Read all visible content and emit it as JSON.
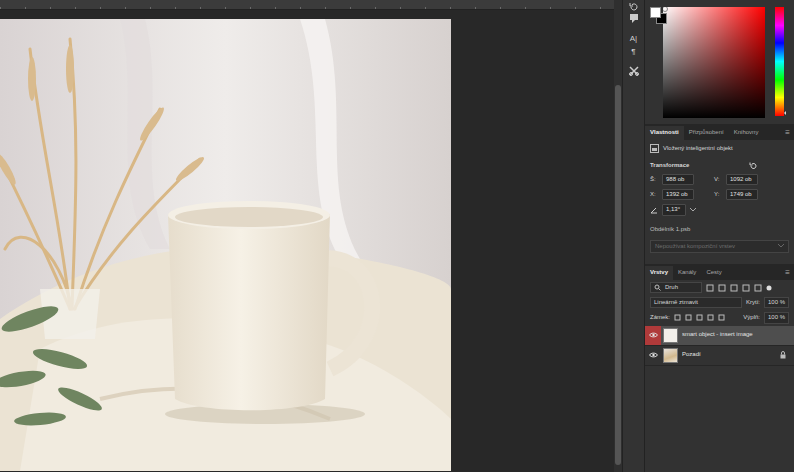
{
  "tool_icons": [
    {
      "glyph": "A|"
    },
    {
      "glyph": "¶"
    }
  ],
  "color": {
    "foreground": "#ffffff",
    "background": "#000000"
  },
  "properties": {
    "tabs": [
      {
        "label": "Vlastnosti",
        "selected": true
      },
      {
        "label": "Přizpůsobení",
        "selected": false
      },
      {
        "label": "Knihovny",
        "selected": false
      }
    ],
    "menu": "≡",
    "subtitle": "Vložený inteligentní objekt",
    "section": "Transformace",
    "fields": [
      {
        "label": "Š:",
        "value": "988 ob"
      },
      {
        "label": "V:",
        "value": "1092 ob"
      },
      {
        "label": "X:",
        "value": "1392 ob"
      },
      {
        "label": "Y:",
        "value": "1749 ob"
      }
    ],
    "angle": "1,13°",
    "file": "Obdélník 1.psb",
    "comp_select": {
      "value": "Nepoužívat kompoziční vrstev",
      "disabled": true
    }
  },
  "layers": {
    "tabs": [
      {
        "label": "Vrstvy",
        "selected": true
      },
      {
        "label": "Kanály",
        "selected": false
      },
      {
        "label": "Cesty",
        "selected": false
      }
    ],
    "menu": "≡",
    "filter": "Druh",
    "blend_mode": "Lineárně ztmavit",
    "opacity_label": "Krytí:",
    "opacity": "100 %",
    "lock_label": "Zámek:",
    "fill_label": "Výplň:",
    "fill": "100 %",
    "items": [
      {
        "name": "smart object - insert image",
        "visible": true,
        "selected": true,
        "locked": false,
        "kind": "smart"
      },
      {
        "name": "Pozadí",
        "visible": true,
        "selected": false,
        "locked": true,
        "kind": "image"
      }
    ]
  }
}
